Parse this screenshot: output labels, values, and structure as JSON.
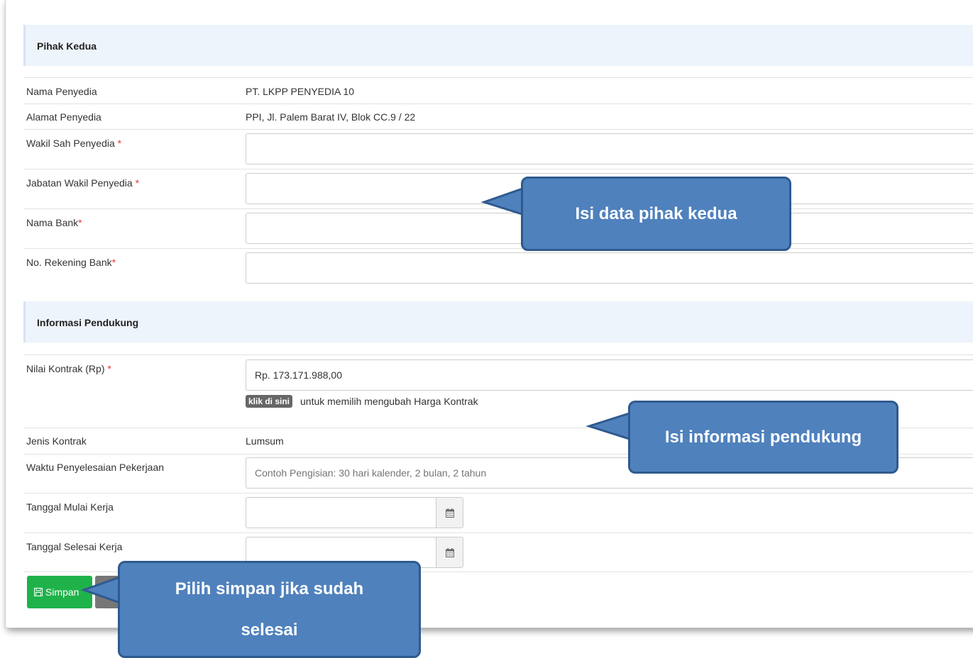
{
  "sections": {
    "pihak_kedua": "Pihak Kedua",
    "informasi_pendukung": "Informasi Pendukung"
  },
  "fields": {
    "nama_penyedia": {
      "label": "Nama Penyedia",
      "value": "PT. LKPP PENYEDIA 10"
    },
    "alamat_penyedia": {
      "label": "Alamat Penyedia",
      "value": "PPI, Jl. Palem Barat IV, Blok CC.9 / 22"
    },
    "wakil_sah": {
      "label": "Wakil Sah Penyedia ",
      "required": "*",
      "value": ""
    },
    "jabatan_wakil": {
      "label": "Jabatan Wakil Penyedia ",
      "required": "*",
      "value": ""
    },
    "nama_bank": {
      "label": "Nama Bank",
      "required": "*",
      "value": ""
    },
    "no_rekening": {
      "label": "No. Rekening Bank",
      "required": "*",
      "value": ""
    },
    "nilai_kontrak": {
      "label": "Nilai Kontrak (Rp) ",
      "required": "*",
      "value": "Rp. 173.171.988,00",
      "badge": "klik di sini",
      "hint": "untuk memilih mengubah Harga Kontrak"
    },
    "jenis_kontrak": {
      "label": "Jenis Kontrak",
      "value": "Lumsum"
    },
    "waktu_penyelesaian": {
      "label": "Waktu Penyelesaian Pekerjaan",
      "placeholder": "Contoh Pengisian: 30 hari kalender, 2 bulan, 2 tahun"
    },
    "tanggal_mulai": {
      "label": "Tanggal Mulai Kerja",
      "value": ""
    },
    "tanggal_selesai": {
      "label": "Tanggal Selesai Kerja",
      "value": ""
    }
  },
  "buttons": {
    "simpan": "Simpan"
  },
  "callouts": {
    "pihak_kedua": "Isi data pihak kedua",
    "informasi": "Isi informasi pendukung",
    "simpan_line1": "Pilih simpan jika sudah",
    "simpan_line2": "selesai"
  },
  "colors": {
    "callout_fill": "#4f81bd",
    "callout_border": "#2f5a8e",
    "save_button": "#1fb24a",
    "required": "#e53935",
    "section_bg": "#eef4fb"
  },
  "icons": {
    "calendar": "calendar-icon",
    "save": "floppy-disk-icon"
  }
}
